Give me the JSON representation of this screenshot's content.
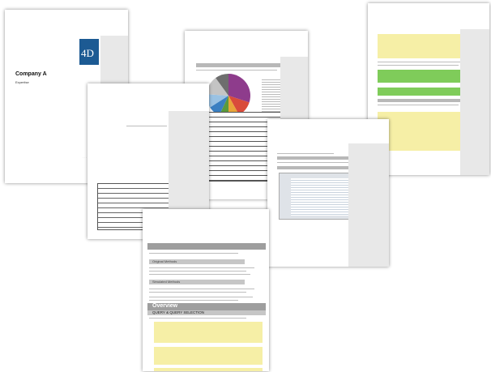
{
  "cover": {
    "logo": "4D",
    "company": "Company A",
    "subtitle": "Expertise"
  },
  "colors": {
    "logo_blue": "#1c5a93",
    "code_yellow": "#f6efa6",
    "code_green": "#7fcc5a",
    "header_gray": "#b8b8b8"
  },
  "pie_page": {
    "slices": [
      {
        "color": "#8e3c8c",
        "share": 0.3
      },
      {
        "color": "#d94b3b",
        "share": 0.12
      },
      {
        "color": "#e8a53a",
        "share": 0.08
      },
      {
        "color": "#5a9a3c",
        "share": 0.07
      },
      {
        "color": "#3a7fc1",
        "share": 0.09
      },
      {
        "color": "#9ac2e3",
        "share": 0.1
      },
      {
        "color": "#c4c4c4",
        "share": 0.14
      },
      {
        "color": "#6e6e6e",
        "share": 0.1
      }
    ]
  },
  "overview": {
    "heading": "Overview",
    "subheading": "QUERY & QUERY SELECTION",
    "methods_heading": "Original Methods",
    "simulated_heading": "Simulated Methods"
  }
}
